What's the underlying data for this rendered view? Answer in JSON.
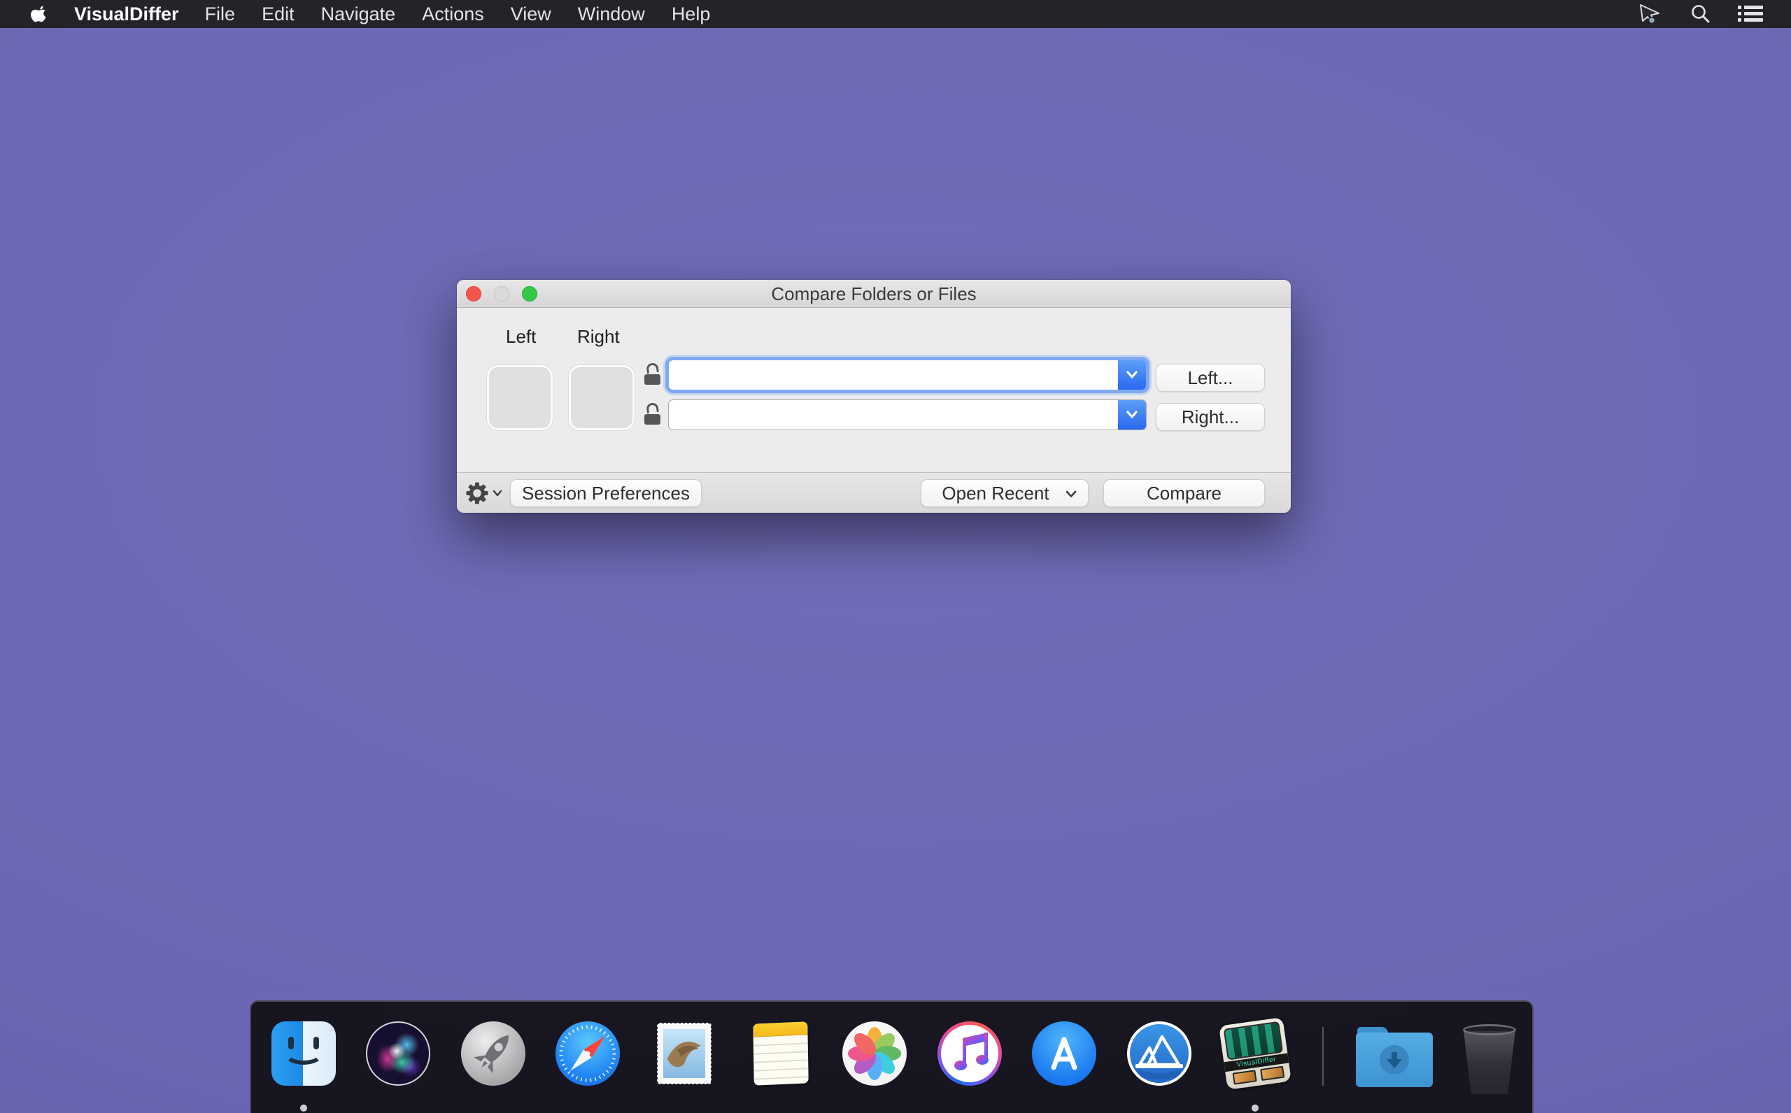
{
  "menu_bar": {
    "app_name": "VisualDiffer",
    "menus": [
      "File",
      "Edit",
      "Navigate",
      "Actions",
      "View",
      "Window",
      "Help"
    ],
    "status_icons": [
      "pointer",
      "search",
      "notification-list"
    ]
  },
  "dialog": {
    "title": "Compare Folders or Files",
    "left_column_label": "Left",
    "right_column_label": "Right",
    "left_path_value": "",
    "right_path_value": "",
    "left_browse_button": "Left...",
    "right_browse_button": "Right...",
    "session_preferences_button": "Session Preferences",
    "open_recent_button": "Open Recent",
    "compare_button": "Compare"
  },
  "dock": {
    "icons": [
      "finder",
      "siri",
      "launchpad",
      "safari",
      "mail",
      "notes",
      "photos",
      "itunes",
      "app-store",
      "mountain-app",
      "visualdiffer",
      "downloads-folder",
      "trash"
    ],
    "visualdiffer_icon_text": "VisualDiffer",
    "running_apps": [
      "finder",
      "visualdiffer"
    ]
  },
  "colors": {
    "wallpaper": "#6b67b4",
    "menu_bar": "#242329",
    "accent_blue": "#2f6fe8",
    "focus_ring": "#6e9ef3",
    "traffic_close": "#f4554c",
    "traffic_minimize": "#dadada",
    "traffic_zoom": "#34c748"
  }
}
